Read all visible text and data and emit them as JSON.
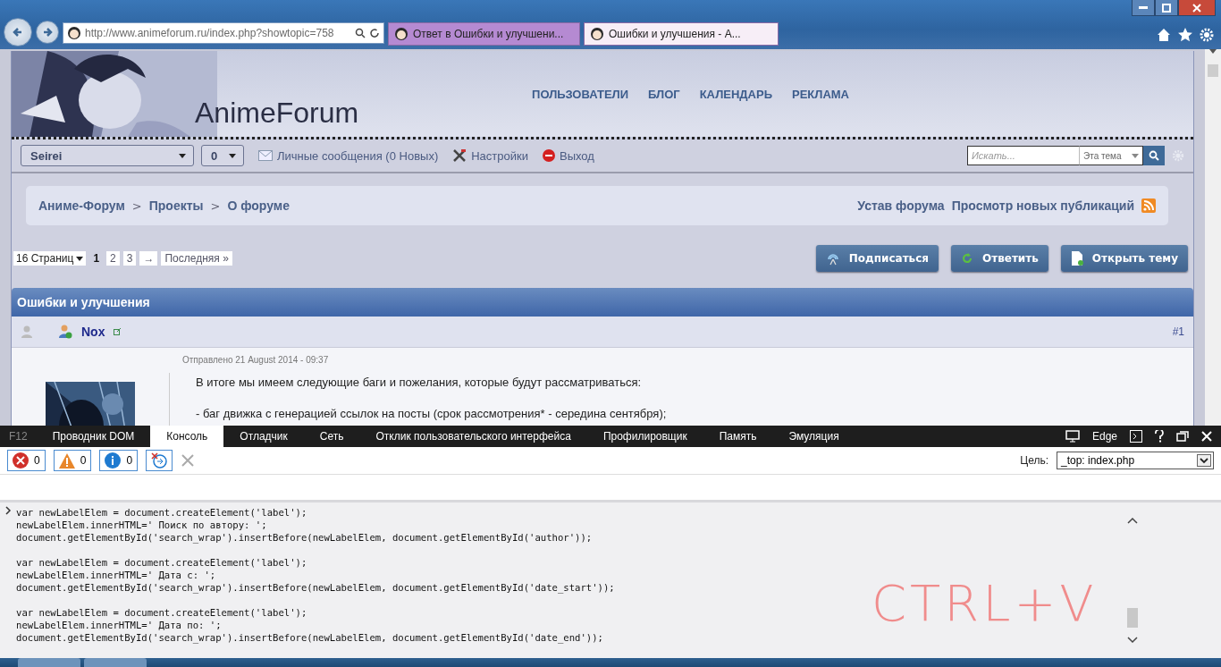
{
  "browser": {
    "url": "http://www.animeforum.ru/index.php?showtopic=758",
    "tabs": [
      {
        "title": "Ответ в Ошибки и улучшени...",
        "selected": false
      },
      {
        "title": "Ошибки и улучшения - A...",
        "selected": true
      }
    ]
  },
  "header": {
    "logo": "AnimeForum",
    "nav": [
      "ПОЛЬЗОВАТЕЛИ",
      "БЛОГ",
      "КАЛЕНДАРЬ",
      "РЕКЛАМА"
    ]
  },
  "userbar": {
    "user": "Seirei",
    "count": "0",
    "links": [
      {
        "kind": "mail",
        "label": "Личные сообщения (0 Новых)"
      },
      {
        "kind": "tools",
        "label": "Настройки"
      },
      {
        "kind": "exit",
        "label": "Выход"
      }
    ],
    "search_placeholder": "Искать...",
    "scope": "Эта тема"
  },
  "breadcrumbs": [
    "Аниме-Форум",
    "Проекты",
    "О форуме"
  ],
  "breadcrumb_separators": [
    ">",
    ">"
  ],
  "right_links": [
    "Устав форума",
    "Просмотр новых публикаций"
  ],
  "pagination": {
    "pages_select": "16 Страниц",
    "pages": [
      {
        "label": "1",
        "selected": true
      },
      {
        "label": "2",
        "selected": false
      },
      {
        "label": "3",
        "selected": false
      }
    ],
    "next": "→",
    "last": "Последняя »"
  },
  "actions": [
    {
      "kind": "subscribe",
      "label": "Подписаться"
    },
    {
      "kind": "reply",
      "label": "Ответить"
    },
    {
      "kind": "new",
      "label": "Открыть тему"
    }
  ],
  "topic": {
    "title": "Ошибки и улучшения",
    "post": {
      "author": "Nox",
      "number": "#1",
      "date": "Отправлено 21 August 2014 - 09:37",
      "lines": [
        "В итоге мы имеем следующие баги и пожелания, которые будут рассматриваться:",
        "- баг движка с генерацией ссылок на посты (срок рассмотрения* - середина сентября);"
      ]
    }
  },
  "devtools": {
    "key": "F12",
    "tabs": [
      {
        "label": "Проводник DOM",
        "selected": false
      },
      {
        "label": "Консоль",
        "selected": true
      },
      {
        "label": "Отладчик",
        "selected": false
      },
      {
        "label": "Сеть",
        "selected": false
      },
      {
        "label": "Отклик пользовательского интерфейса",
        "selected": false
      },
      {
        "label": "Профилировщик",
        "selected": false
      },
      {
        "label": "Память",
        "selected": false
      },
      {
        "label": "Эмуляция",
        "selected": false
      }
    ],
    "mode": "Edge",
    "counters": [
      {
        "kind": "error",
        "count": "0"
      },
      {
        "kind": "warning",
        "count": "0"
      },
      {
        "kind": "info",
        "count": "0"
      }
    ],
    "target_label": "Цель:",
    "target": "_top: index.php",
    "code_blocks": [
      [
        "var newLabelElem = document.createElement('label');",
        "newLabelElem.innerHTML=' Поиск по автору: ';",
        "document.getElementById('search_wrap').insertBefore(newLabelElem, document.getElementById('author'));"
      ],
      [
        "var newLabelElem = document.createElement('label');",
        "newLabelElem.innerHTML=' Дата с: ';",
        "document.getElementById('search_wrap').insertBefore(newLabelElem, document.getElementById('date_start'));"
      ],
      [
        "var newLabelElem = document.createElement('label');",
        "newLabelElem.innerHTML=' Дата по: ';",
        "document.getElementById('search_wrap').insertBefore(newLabelElem, document.getElementById('date_end'));"
      ]
    ],
    "handwriting": "CTRL+V"
  }
}
